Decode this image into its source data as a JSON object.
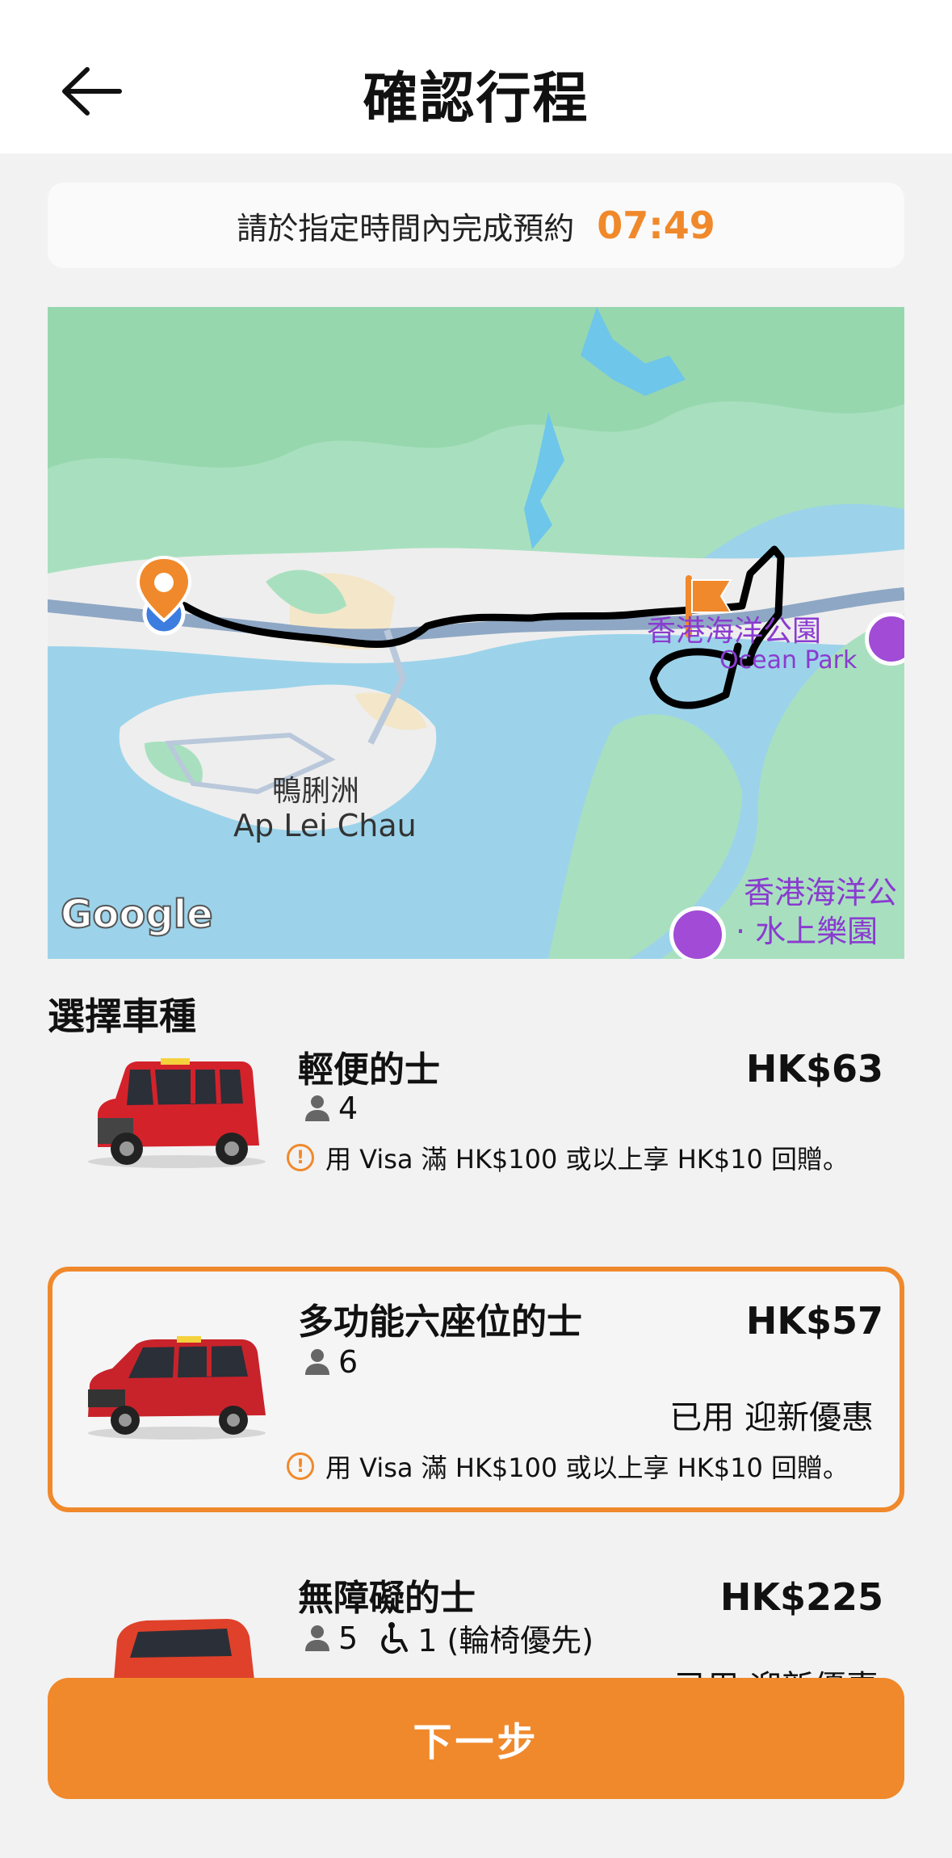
{
  "header": {
    "title": "確認行程"
  },
  "timer": {
    "text": "請於指定時間內完成預約",
    "value": "07:49"
  },
  "map": {
    "labels": {
      "ap_lei_chau_zh": "鴨脷洲",
      "ap_lei_chau_en": "Ap Lei Chau",
      "ocean_park_zh": "香港海洋公園",
      "ocean_park_en": "Ocean Park",
      "water_world_line1": "香港海洋公",
      "water_world_line2": "· 水上樂園",
      "google": "Google"
    }
  },
  "section": {
    "title": "選擇車種"
  },
  "vehicles": [
    {
      "name": "輕便的士",
      "price": "HK$63",
      "passengers": "4",
      "promo": "用 Visa 滿 HK$100 或以上享 HK$10 回贈。"
    },
    {
      "name": "多功能六座位的士",
      "price": "HK$57",
      "passengers": "6",
      "applied": "已用 迎新優惠",
      "promo": "用 Visa 滿 HK$100 或以上享 HK$10 回贈。"
    },
    {
      "name": "無障礙的士",
      "price": "HK$225",
      "passengers": "5",
      "wheelchair": "1 (輪椅優先)",
      "applied": "已用 迎新優惠"
    }
  ],
  "footer": {
    "next_label": "下一步"
  },
  "colors": {
    "accent": "#f0892b",
    "map_water": "#9cd3ea",
    "map_land": "#a8e0bf"
  },
  "icons": [
    "back-arrow-icon",
    "person-icon",
    "wheelchair-icon",
    "info-icon",
    "pickup-pin-icon",
    "destination-flag-icon",
    "attraction-icon"
  ]
}
